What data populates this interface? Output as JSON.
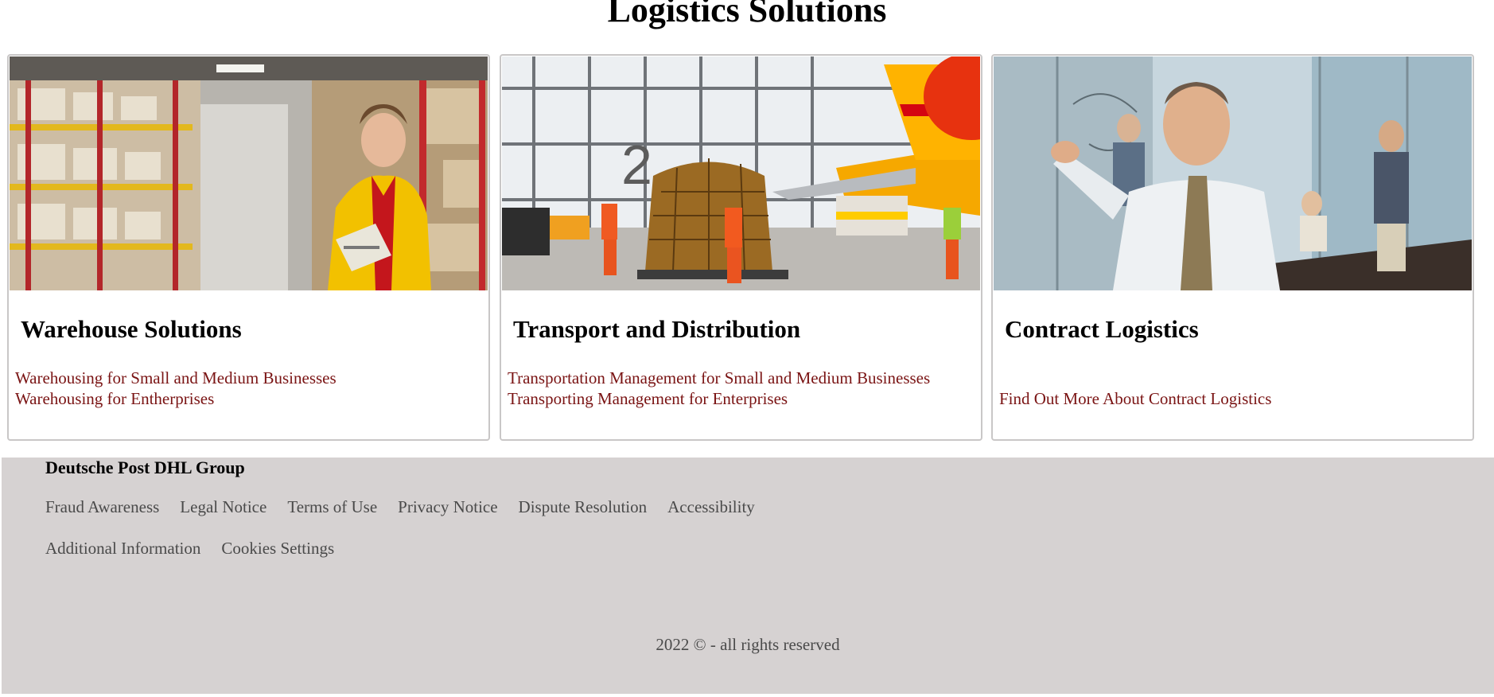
{
  "page": {
    "title": "Logistics Solutions"
  },
  "cards": [
    {
      "title": "Warehouse Solutions",
      "image": "warehouse-worker-photo",
      "links": [
        "Warehousing for Small and Medium Businesses",
        "Warehousing for Entherprises"
      ]
    },
    {
      "title": "Transport and Distribution",
      "image": "air-cargo-hangar-photo",
      "links": [
        "Transportation Management for Small and Medium Businesses",
        "Transporting Management for Enterprises"
      ]
    },
    {
      "title": "Contract Logistics",
      "image": "business-meeting-photo",
      "links": [
        "Find Out More About Contract Logistics"
      ]
    }
  ],
  "footer": {
    "brand": "Deutsche Post DHL Group",
    "links_row1": [
      "Fraud Awareness",
      "Legal Notice",
      "Terms of Use",
      "Privacy Notice",
      "Dispute Resolution",
      "Accessibility"
    ],
    "links_row2": [
      "Additional Information",
      "Cookies Settings"
    ],
    "copyright": "2022 © - all rights reserved"
  },
  "colors": {
    "link": "#7a1414",
    "footer_bg": "#d6d2d2",
    "footer_text": "#4a4a4a",
    "card_border": "#c9c7c7",
    "dhl_yellow": "#ffcc00",
    "dhl_red": "#d40511"
  }
}
